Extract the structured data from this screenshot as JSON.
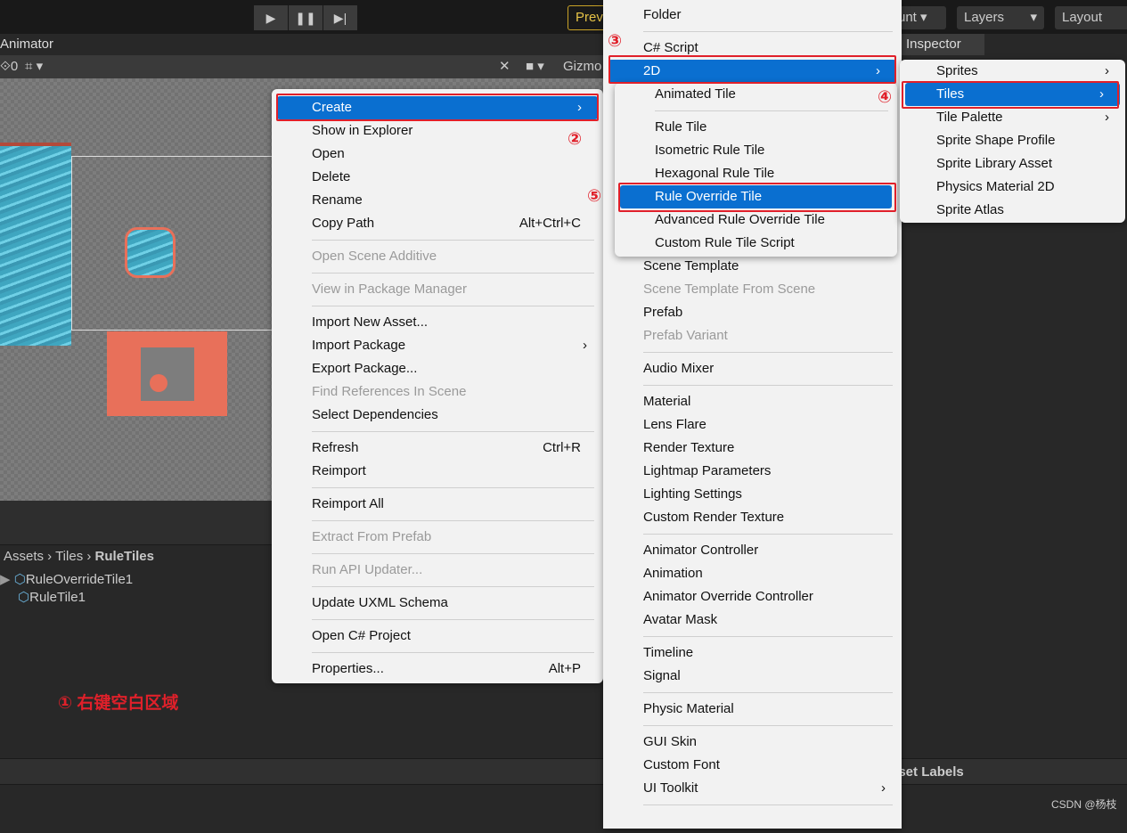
{
  "toolbar": {
    "play": "▶",
    "pause": "❚❚",
    "step": "▶|",
    "preview": "Prev",
    "account": "unt",
    "layers": "Layers",
    "layout": "Layout"
  },
  "tabs": {
    "animator": "Animator",
    "inspector": "Inspector"
  },
  "scene_toolbar": {
    "layers_count": "0",
    "gizmos": "Gizmo"
  },
  "project": {
    "breadcrumb": [
      "Assets",
      "Tiles",
      "RuleTiles"
    ],
    "items": [
      "RuleOverrideTile1",
      "RuleTile1"
    ]
  },
  "asset_labels": "sset Labels",
  "watermark": "CSDN @杨枝",
  "annotations": {
    "n1": "① 右键空白区域",
    "n2": "②",
    "n3": "③",
    "n4": "④",
    "n5": "⑤"
  },
  "context_menu": [
    {
      "label": "Create",
      "arrow": "›",
      "hl": true
    },
    {
      "label": "Show in Explorer"
    },
    {
      "label": "Open"
    },
    {
      "label": "Delete"
    },
    {
      "label": "Rename"
    },
    {
      "label": "Copy Path",
      "shortcut": "Alt+Ctrl+C"
    },
    {
      "sep": true
    },
    {
      "label": "Open Scene Additive",
      "disabled": true
    },
    {
      "sep": true
    },
    {
      "label": "View in Package Manager",
      "disabled": true
    },
    {
      "sep": true
    },
    {
      "label": "Import New Asset..."
    },
    {
      "label": "Import Package",
      "arrow": "›"
    },
    {
      "label": "Export Package..."
    },
    {
      "label": "Find References In Scene",
      "disabled": true
    },
    {
      "label": "Select Dependencies"
    },
    {
      "sep": true
    },
    {
      "label": "Refresh",
      "shortcut": "Ctrl+R"
    },
    {
      "label": "Reimport"
    },
    {
      "sep": true
    },
    {
      "label": "Reimport All"
    },
    {
      "sep": true
    },
    {
      "label": "Extract From Prefab",
      "disabled": true
    },
    {
      "sep": true
    },
    {
      "label": "Run API Updater...",
      "disabled": true
    },
    {
      "sep": true
    },
    {
      "label": "Update UXML Schema"
    },
    {
      "sep": true
    },
    {
      "label": "Open C# Project"
    },
    {
      "sep": true
    },
    {
      "label": "Properties...",
      "shortcut": "Alt+P"
    }
  ],
  "create_menu_top": [
    {
      "label": "Folder"
    },
    {
      "sep": true
    },
    {
      "label": "C# Script"
    },
    {
      "label": "2D",
      "arrow": "›",
      "hl": true
    }
  ],
  "create_menu": [
    {
      "label": "Scene Template"
    },
    {
      "label": "Scene Template From Scene",
      "disabled": true
    },
    {
      "label": "Prefab"
    },
    {
      "label": "Prefab Variant",
      "disabled": true
    },
    {
      "sep": true
    },
    {
      "label": "Audio Mixer"
    },
    {
      "sep": true
    },
    {
      "label": "Material"
    },
    {
      "label": "Lens Flare"
    },
    {
      "label": "Render Texture"
    },
    {
      "label": "Lightmap Parameters"
    },
    {
      "label": "Lighting Settings"
    },
    {
      "label": "Custom Render Texture"
    },
    {
      "sep": true
    },
    {
      "label": "Animator Controller"
    },
    {
      "label": "Animation"
    },
    {
      "label": "Animator Override Controller"
    },
    {
      "label": "Avatar Mask"
    },
    {
      "sep": true
    },
    {
      "label": "Timeline"
    },
    {
      "label": "Signal"
    },
    {
      "sep": true
    },
    {
      "label": "Physic Material"
    },
    {
      "sep": true
    },
    {
      "label": "GUI Skin"
    },
    {
      "label": "Custom Font"
    },
    {
      "label": "UI Toolkit",
      "arrow": "›"
    },
    {
      "sep": true
    },
    {
      "label": ""
    }
  ],
  "menu_2d": [
    {
      "label": "Animated Tile"
    },
    {
      "sep": true
    },
    {
      "label": "Rule Tile"
    },
    {
      "label": "Isometric Rule Tile"
    },
    {
      "label": "Hexagonal Rule Tile"
    },
    {
      "label": "Rule Override Tile",
      "hl": true
    },
    {
      "label": "Advanced Rule Override Tile"
    },
    {
      "label": "Custom Rule Tile Script"
    }
  ],
  "menu_tiles": [
    {
      "label": "Sprites",
      "arrow": "›"
    },
    {
      "label": "Tiles",
      "arrow": "›",
      "hl": true
    },
    {
      "label": "Tile Palette",
      "arrow": "›"
    },
    {
      "label": "Sprite Shape Profile"
    },
    {
      "label": "Sprite Library Asset"
    },
    {
      "label": "Physics Material 2D"
    },
    {
      "label": "Sprite Atlas"
    }
  ],
  "colors": {
    "highlight": "#0a6fd0",
    "annotation": "#e0202a",
    "tile_orange": "#e8705a"
  }
}
